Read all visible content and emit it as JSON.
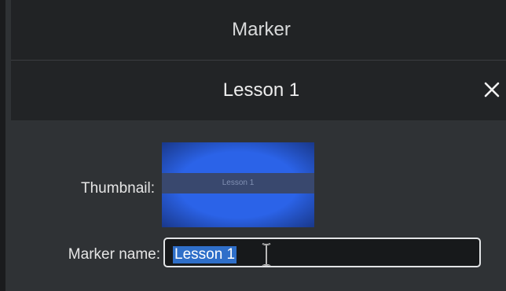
{
  "window": {
    "title": "Marker"
  },
  "marker": {
    "header": "Lesson 1",
    "close_icon": "close-icon"
  },
  "form": {
    "thumbnail_label": "Thumbnail:",
    "thumbnail_text": "Lesson 1",
    "name_label": "Marker name:",
    "name_value": "Lesson 1",
    "name_selected": true
  },
  "colors": {
    "background": "#2f3235",
    "title_bar": "#212325",
    "thumbnail_blue": "#2b63e8",
    "selection": "#2f6fc9"
  }
}
